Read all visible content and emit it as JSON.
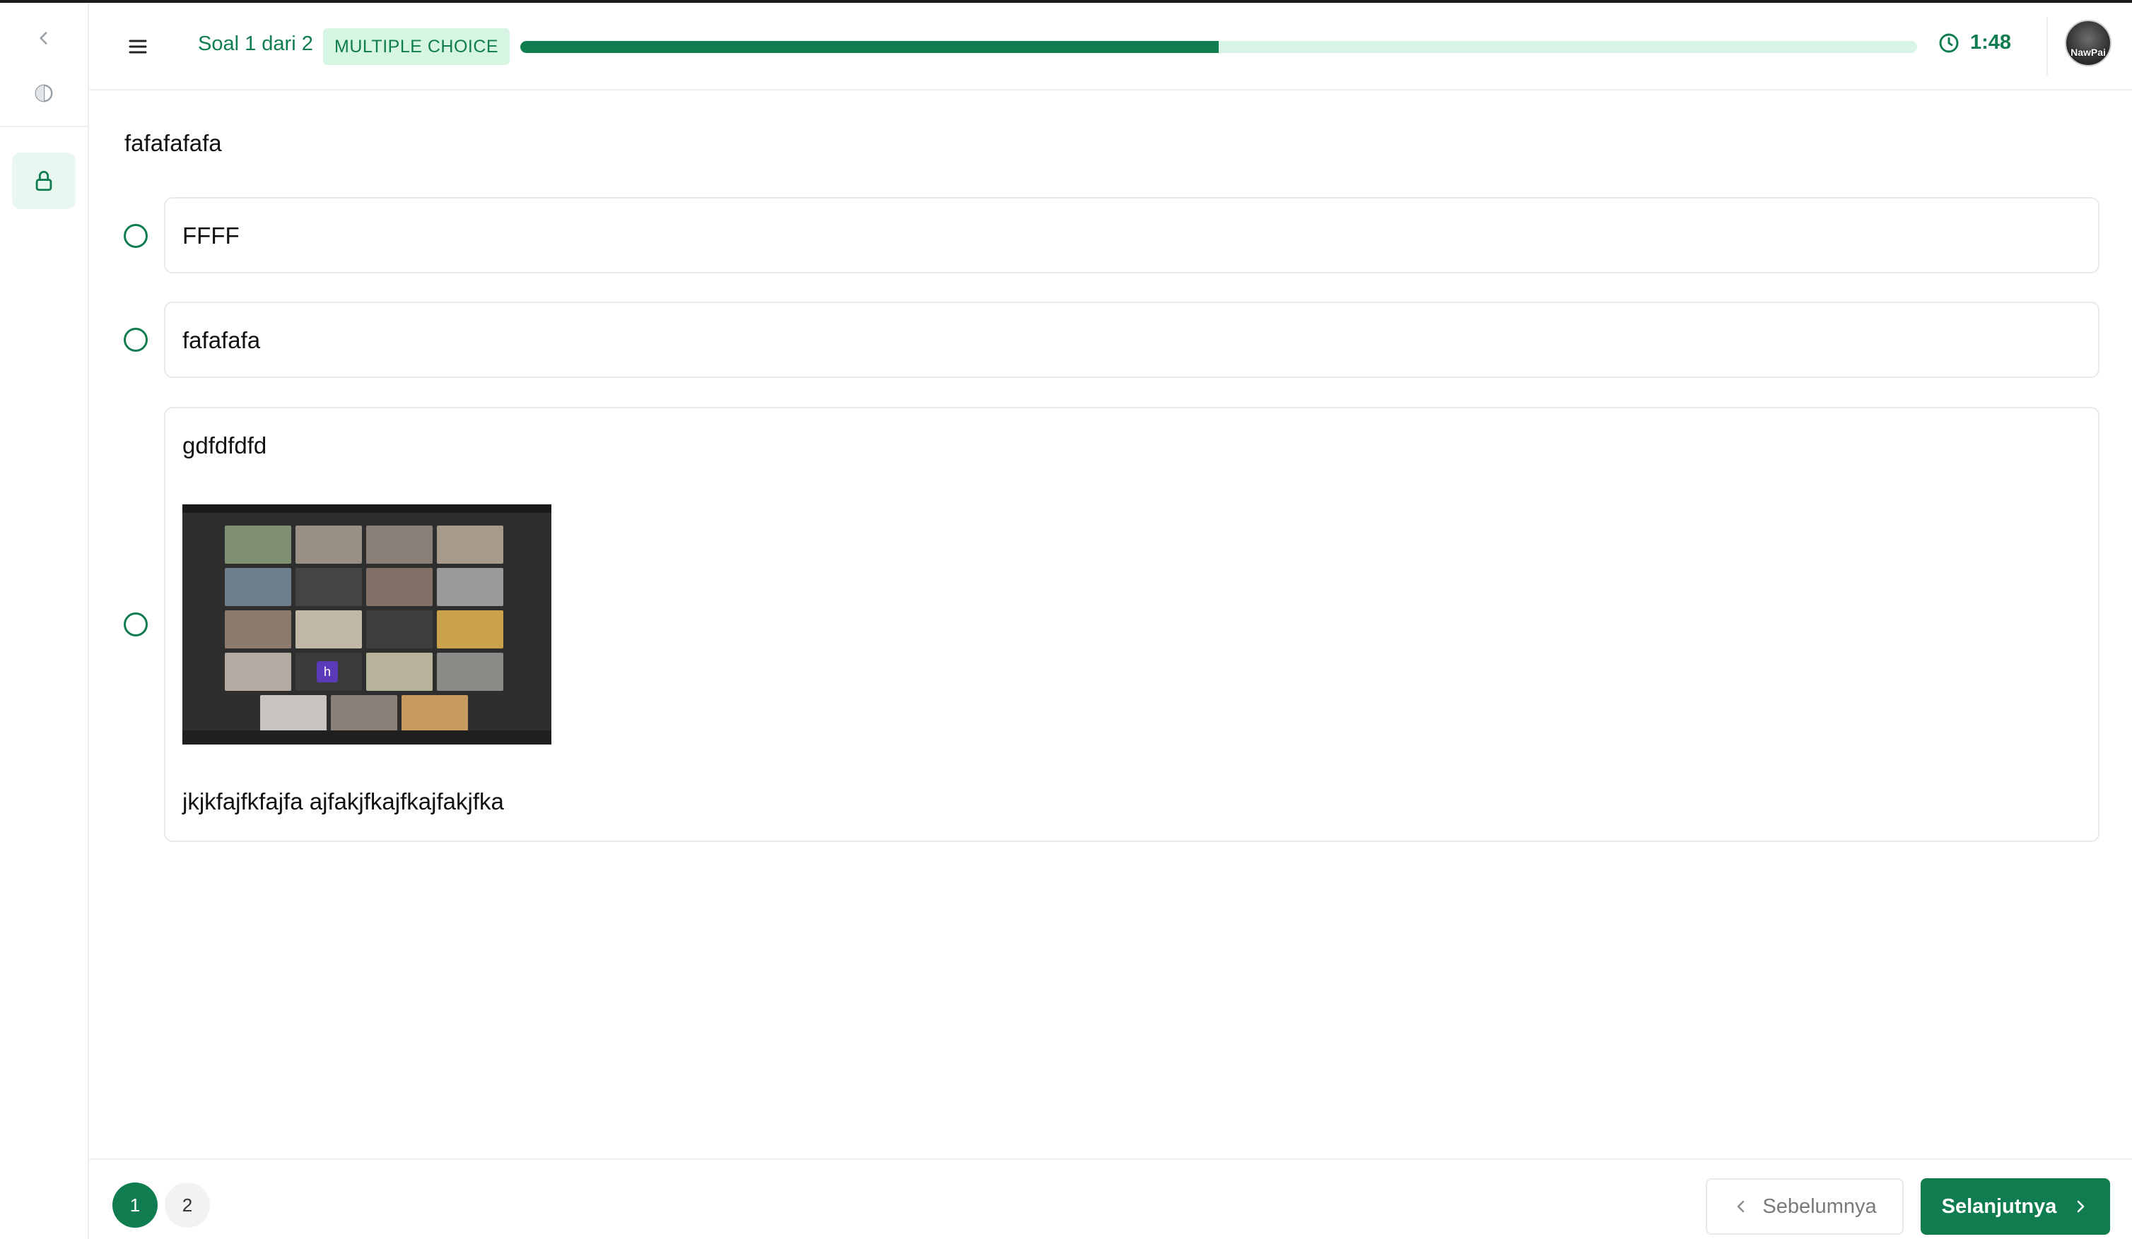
{
  "header": {
    "soal_label": "Soal 1 dari 2",
    "type_badge": "MULTIPLE CHOICE",
    "progress_fraction": 0.5,
    "timer": "1:48",
    "avatar_text": "NawPai"
  },
  "question": {
    "text": "fafafafafa",
    "options": [
      {
        "text": "FFFF"
      },
      {
        "text": "fafafafa"
      },
      {
        "text_top": "gdfdfdfd",
        "image": "screenshot of video-call participant grid",
        "text_bottom": "jkjkfajfkfajfa ajfakjfkajfkajfakjfka"
      }
    ]
  },
  "pagination": {
    "pages": [
      "1",
      "2"
    ],
    "current": "1"
  },
  "nav": {
    "prev_label": "Sebelumnya",
    "next_label": "Selanjutnya"
  },
  "colors": {
    "accent": "#0f7d4f",
    "accent_light": "#d6f5e3",
    "progress_track": "#d9f5e6"
  },
  "icons": {
    "rail": [
      "chevron-left-icon",
      "theme-contrast-icon",
      "lock-icon"
    ],
    "header": [
      "menu-icon",
      "clock-icon"
    ]
  }
}
